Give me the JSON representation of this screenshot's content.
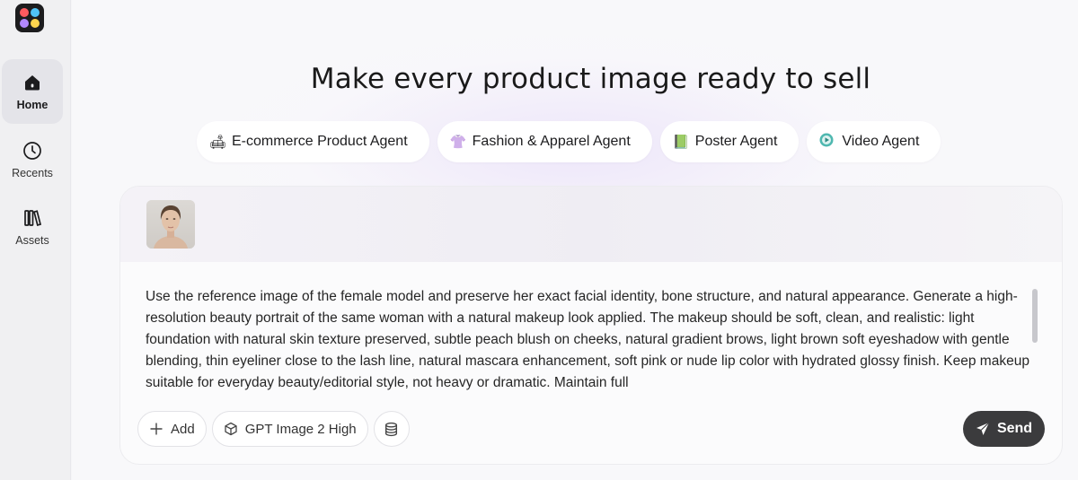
{
  "sidebar": {
    "items": [
      {
        "label": "Home",
        "icon": "home-icon",
        "active": true
      },
      {
        "label": "Recents",
        "icon": "clock-icon",
        "active": false
      },
      {
        "label": "Assets",
        "icon": "books-icon",
        "active": false
      }
    ]
  },
  "main": {
    "headline": "Make every product image ready to sell",
    "agents": [
      {
        "label": "E-commerce Product Agent",
        "emoji": "🛋"
      },
      {
        "label": "Fashion & Apparel Agent",
        "emoji": "👚"
      },
      {
        "label": "Poster Agent",
        "emoji": "📗"
      },
      {
        "label": "Video Agent",
        "emoji": "🎬"
      }
    ]
  },
  "composer": {
    "prompt": "Use the reference image of the female model and preserve her exact facial identity, bone structure, and natural appearance. Generate a high-resolution beauty portrait of the same woman with a natural makeup look applied. The makeup should be soft, clean, and realistic: light foundation with natural skin texture preserved, subtle peach blush on cheeks, natural gradient brows, light brown soft eyeshadow with gentle blending, thin eyeliner close to the lash line, natural mascara enhancement, soft pink or nude lip color with hydrated glossy finish. Keep makeup suitable for everyday beauty/editorial style, not heavy or dramatic. Maintain full",
    "add_label": "Add",
    "model_label": "GPT Image 2 High",
    "send_label": "Send"
  },
  "colors": {
    "send_bg": "#3b3b3d",
    "sidebar_active": "#e4e4e9"
  }
}
